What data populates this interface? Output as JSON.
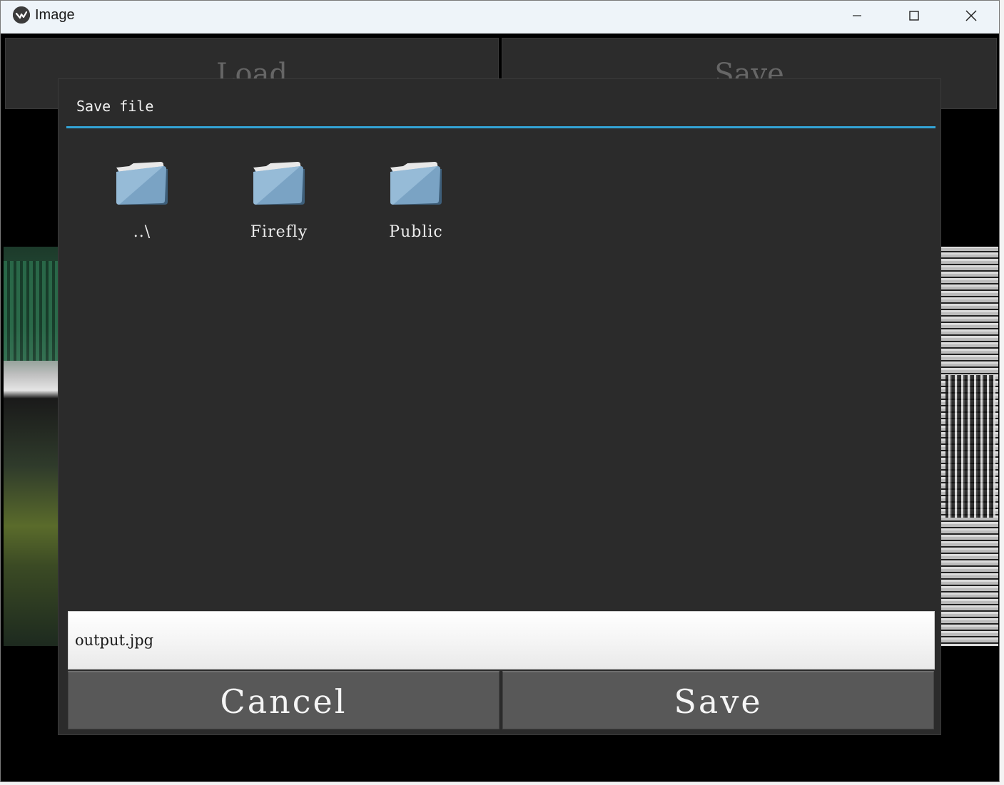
{
  "window": {
    "title": "Image"
  },
  "toolbar": {
    "load_label": "Load",
    "save_label": "Save"
  },
  "dialog": {
    "title": "Save file",
    "accent_color": "#33a4d6",
    "items": [
      {
        "label": "..\\",
        "icon": "folder-icon"
      },
      {
        "label": "Firefly",
        "icon": "folder-icon"
      },
      {
        "label": "Public",
        "icon": "folder-icon"
      }
    ],
    "filename": "output.jpg",
    "cancel_label": "Cancel",
    "save_label": "Save"
  }
}
